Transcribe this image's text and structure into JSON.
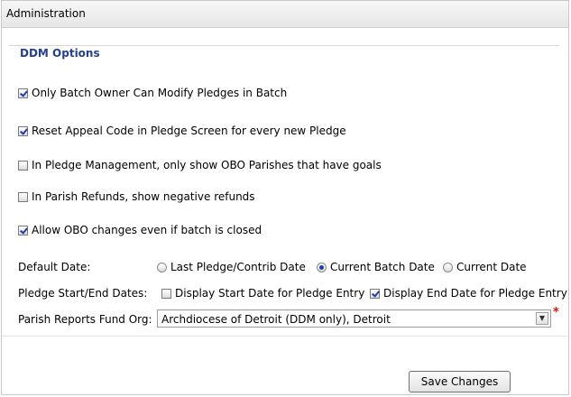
{
  "panel": {
    "title": "Administration"
  },
  "ddm": {
    "legend": "DDM Options",
    "checkboxes": [
      {
        "label": "Only Batch Owner Can Modify Pledges in Batch",
        "checked": true
      },
      {
        "label": "Reset Appeal Code in Pledge Screen for every new Pledge",
        "checked": true
      },
      {
        "label": "In Pledge Management, only show OBO Parishes that have goals",
        "checked": false
      },
      {
        "label": "In Parish Refunds, show negative refunds",
        "checked": false
      },
      {
        "label": "Allow OBO changes even if batch is closed",
        "checked": true
      }
    ]
  },
  "default_date": {
    "label": "Default Date:",
    "options": [
      {
        "label": "Last Pledge/Contrib Date",
        "checked": false
      },
      {
        "label": "Current Batch Date",
        "checked": true
      },
      {
        "label": "Current Date",
        "checked": false
      }
    ]
  },
  "pledge_dates": {
    "label": "Pledge Start/End Dates:",
    "options": [
      {
        "label": "Display Start Date for Pledge Entry",
        "checked": false
      },
      {
        "label": "Display End Date for Pledge Entry",
        "checked": true
      }
    ]
  },
  "fund_org": {
    "label": "Parish Reports Fund Org:",
    "value": "Archdiocese of Detroit (DDM only), Detroit",
    "required_mark": "*"
  },
  "buttons": {
    "save": "Save Changes"
  },
  "colors": {
    "accent": "#1f3fa8",
    "legend": "#26408b",
    "required": "#dd1111"
  }
}
